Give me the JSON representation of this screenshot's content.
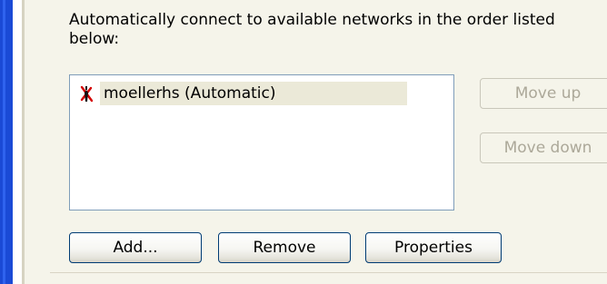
{
  "description": "Automatically connect to available networks in the order listed below:",
  "networks": [
    {
      "label": "moellerhs (Automatic)",
      "icon": "wireless-network-icon"
    }
  ],
  "buttons": {
    "move_up": "Move up",
    "move_down": "Move down",
    "add": "Add...",
    "remove": "Remove",
    "properties": "Properties"
  },
  "colors": {
    "panel_background": "#f5f4ea",
    "window_frame_blue": "#1a4ad6",
    "selected_item_background": "#ebe9d8",
    "disabled_text": "#aca899",
    "listbox_border": "#7f9db9"
  }
}
